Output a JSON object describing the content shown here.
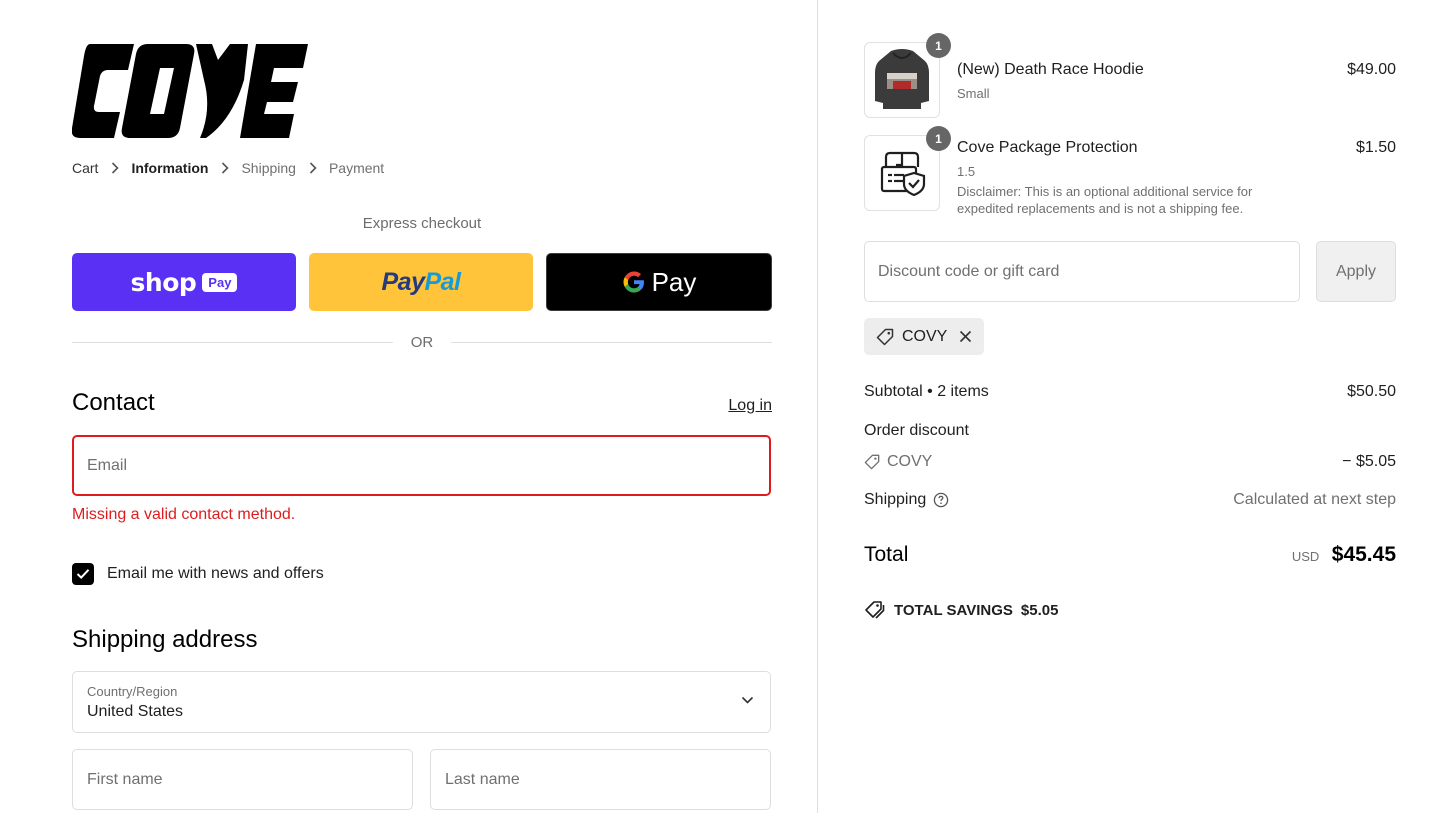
{
  "brand": {
    "logo_text": "COVE"
  },
  "breadcrumb": {
    "items": [
      {
        "label": "Cart",
        "state": "link"
      },
      {
        "label": "Information",
        "state": "current"
      },
      {
        "label": "Shipping",
        "state": "upcoming"
      },
      {
        "label": "Payment",
        "state": "upcoming"
      }
    ]
  },
  "express": {
    "label": "Express checkout",
    "shop_pay": {
      "word": "shop",
      "pill": "Pay"
    },
    "paypal": {
      "part1": "Pay",
      "part2": "Pal"
    },
    "gpay": {
      "word": "Pay"
    },
    "or_label": "OR"
  },
  "contact": {
    "title": "Contact",
    "login_label": "Log in",
    "email_placeholder": "Email",
    "error": "Missing a valid contact method.",
    "newsletter_label": "Email me with news and offers",
    "newsletter_checked": true
  },
  "shipping": {
    "title": "Shipping address",
    "country_label": "Country/Region",
    "country_value": "United States",
    "first_name_placeholder": "First name",
    "last_name_placeholder": "Last name"
  },
  "cart": {
    "items": [
      {
        "qty": "1",
        "name": "(New) Death Race Hoodie",
        "variant": "Small",
        "price": "$49.00",
        "thumb_icon": "hoodie-image"
      },
      {
        "qty": "1",
        "name": "Cove Package Protection",
        "variant": "1.5",
        "disclaimer": "Disclaimer: This is an optional additional service for expedited replacements and is not a shipping fee.",
        "price": "$1.50",
        "thumb_icon": "package-shield-icon"
      }
    ]
  },
  "discount": {
    "placeholder": "Discount code or gift card",
    "apply_label": "Apply",
    "applied_code": "COVY"
  },
  "summary": {
    "subtotal_label": "Subtotal • 2 items",
    "subtotal_value": "$50.50",
    "order_discount_label": "Order discount",
    "discount_code": "COVY",
    "discount_value": "− $5.05",
    "shipping_label": "Shipping",
    "shipping_value": "Calculated at next step",
    "total_label": "Total",
    "currency": "USD",
    "total_value": "$45.45",
    "savings_label": "TOTAL SAVINGS",
    "savings_value": "$5.05"
  },
  "colors": {
    "shop_pay": "#5a31f4",
    "paypal": "#ffc439",
    "error": "#dd1d1d",
    "divider": "#dedede"
  }
}
